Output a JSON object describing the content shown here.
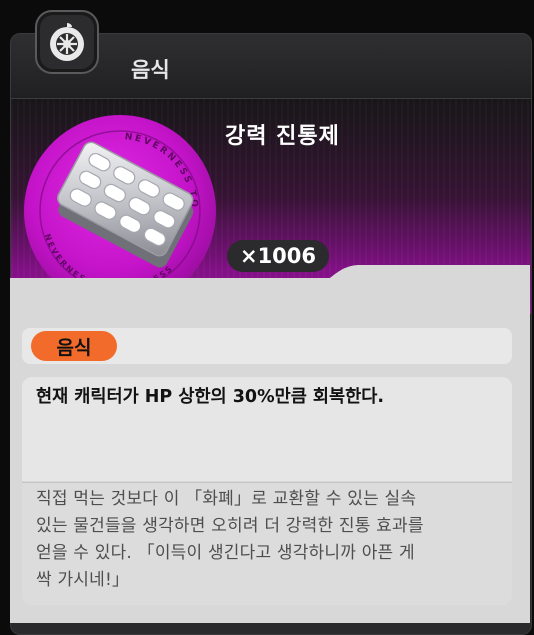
{
  "header": {
    "title": "음식",
    "icon": "tire-icon"
  },
  "item": {
    "name": "강력 진통제",
    "quantity": "×1006",
    "image": "painkiller-blister-pack",
    "emblem_text_top": "NEVERNESS TO EVERNESS",
    "emblem_text_bottom": "NEVERNESS TO EVERNESS"
  },
  "category": {
    "label": "음식"
  },
  "effect": {
    "text": "현재 캐릭터가 HP 상한의 30%만큼 회복한다."
  },
  "flavor": {
    "lines": [
      "직접 먹는 것보다 이 「화폐」로 교환할 수 있는 실속",
      "있는 물건들을 생각하면 오히려 더 강력한 진통 효과를",
      "얻을 수 있다. 「이득이 생긴다고 생각하니까 아픈 게",
      "싹 가시네!」"
    ]
  },
  "colors": {
    "accent_orange": "#f26b2a",
    "hero_magenta": "#9b129f",
    "emblem_pink": "#d21fd6"
  }
}
